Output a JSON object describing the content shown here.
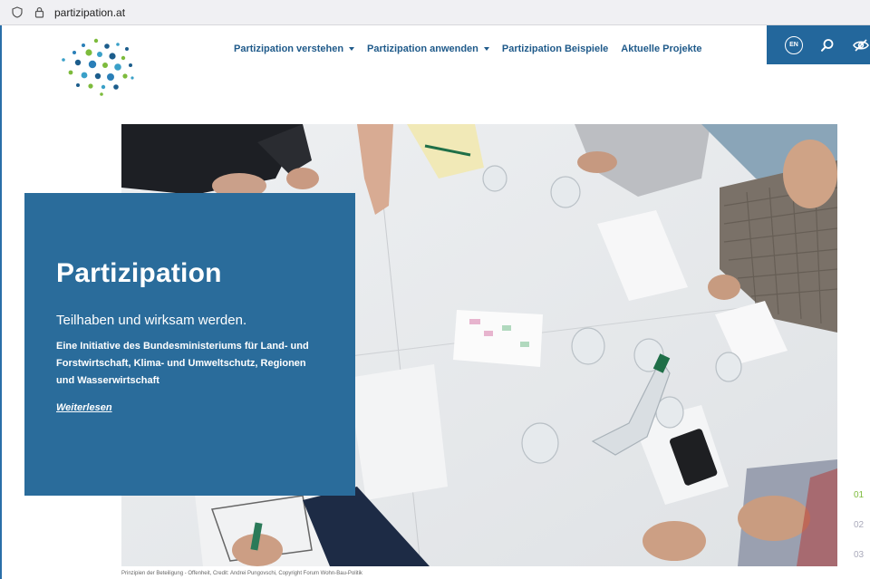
{
  "browser": {
    "url": "partizipation.at"
  },
  "nav": {
    "items": [
      {
        "label": "Partizipation verstehen",
        "dropdown": true
      },
      {
        "label": "Partizipation anwenden",
        "dropdown": true
      },
      {
        "label": "Partizipation Beispiele",
        "dropdown": false
      },
      {
        "label": "Aktuelle Projekte",
        "dropdown": false
      }
    ]
  },
  "tools": {
    "language": "EN",
    "search_icon": "search-icon",
    "accessibility_icon": "eye-slash-icon"
  },
  "hero": {
    "title": "Partizipation",
    "subtitle": "Teilhaben und wirksam werden.",
    "description": "Eine Initiative des Bundesministeriums für Land- und Forstwirtschaft, Klima- und Umweltschutz, Regionen und Wasserwirtschaft",
    "link": "Weiterlesen",
    "caption": "Prinzipien der Beteiligung - Offenheit, Credit: Andrei Pungovschi, Copyright Forum Wohn-Bau-Politik"
  },
  "pager": {
    "items": [
      "01",
      "02",
      "03"
    ],
    "active": 0
  },
  "colors": {
    "brand_blue": "#2a6c9b",
    "nav_blue": "#1f5a8a",
    "accent_green": "#7dbb3c"
  }
}
